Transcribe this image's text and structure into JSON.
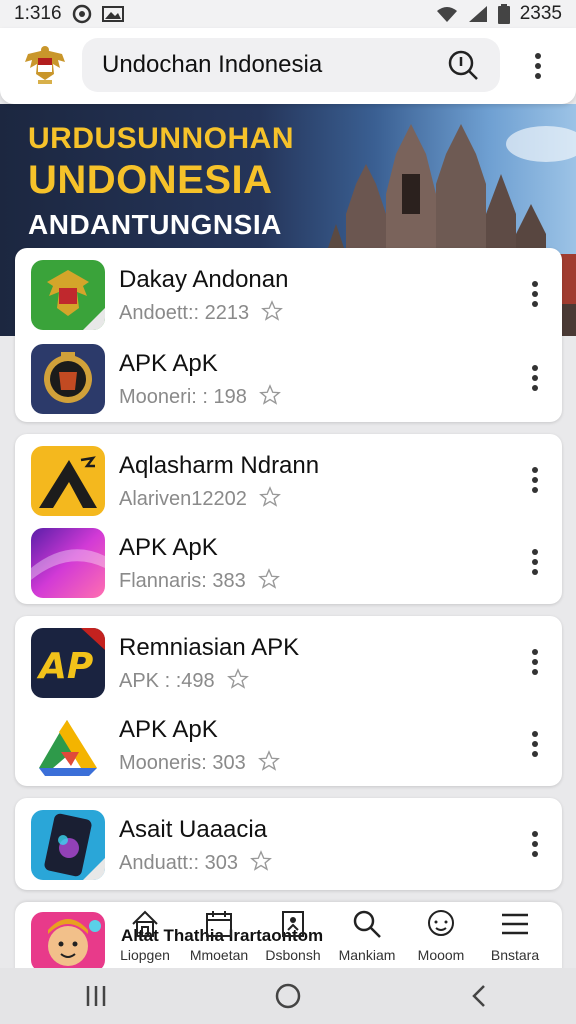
{
  "status_bar": {
    "time": "1:316",
    "battery_text": "2335"
  },
  "search": {
    "value": "Undochan Indonesia"
  },
  "banner": {
    "line1": "URDUSUNNOHAN",
    "line2": "UNDONESIA",
    "line3": "ANDANTUNGNSIA"
  },
  "cards": [
    {
      "items": [
        {
          "title": "Dakay Andonan",
          "subtitle": "Andoett:: 2213"
        },
        {
          "title": "APK ApK",
          "subtitle": "Mooneri: : 198"
        }
      ]
    },
    {
      "items": [
        {
          "title": "Aqlasharm Ndrann",
          "subtitle": "Alariven12202"
        },
        {
          "title": "APK ApK",
          "subtitle": "Flannaris: 383"
        }
      ]
    },
    {
      "items": [
        {
          "title": "Remniasian APK",
          "subtitle": "APK : :498"
        },
        {
          "title": "APK ApK",
          "subtitle": "Mooneris: 303"
        }
      ]
    },
    {
      "items": [
        {
          "title": "Asait Uaaacia",
          "subtitle": "Anduatt:: 303"
        }
      ]
    }
  ],
  "bottom_nav": {
    "overlay_text": "Altat Thathia Irartaontom",
    "items": [
      {
        "label": "Liopgen",
        "icon": "home-icon"
      },
      {
        "label": "Mmoetan",
        "icon": "calendar-icon"
      },
      {
        "label": "Dsbonsh",
        "icon": "bookmark-icon"
      },
      {
        "label": "Mankiam",
        "icon": "search-icon"
      },
      {
        "label": "Mooom",
        "icon": "chat-icon"
      },
      {
        "label": "Bnstara",
        "icon": "menu-icon"
      }
    ]
  },
  "colors": {
    "accent_yellow": "#f6c22a",
    "banner_dark": "#1c2740"
  }
}
